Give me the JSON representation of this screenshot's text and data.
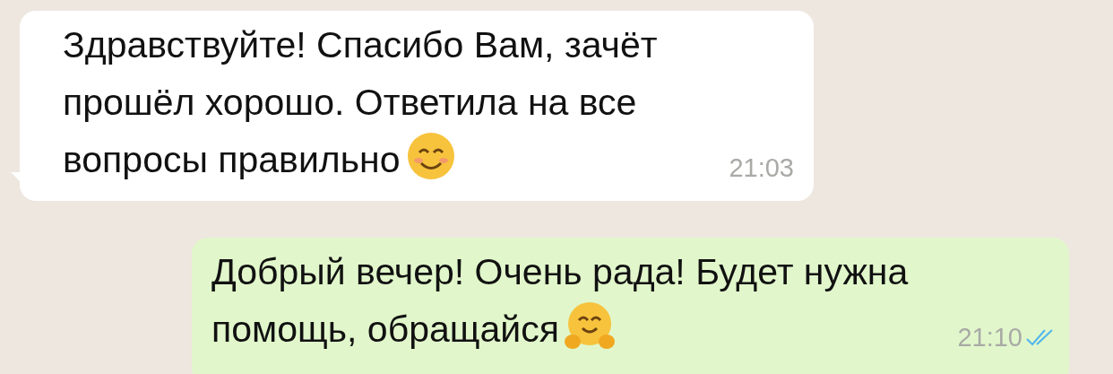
{
  "messages": [
    {
      "kind": "incoming",
      "lines": [
        "Здравствуйте! Спасибо Вам, зачёт",
        "прошёл хорошо. Ответила на все",
        "вопросы правильно"
      ],
      "emoji": {
        "kind": "smile"
      },
      "time": "21:03"
    },
    {
      "kind": "outgoing",
      "lines": [
        "Добрый вечер! Очень рада! Будет нужна",
        "помощь, обращайся"
      ],
      "emoji": {
        "kind": "hug"
      },
      "time": "21:10",
      "read": true
    }
  ]
}
